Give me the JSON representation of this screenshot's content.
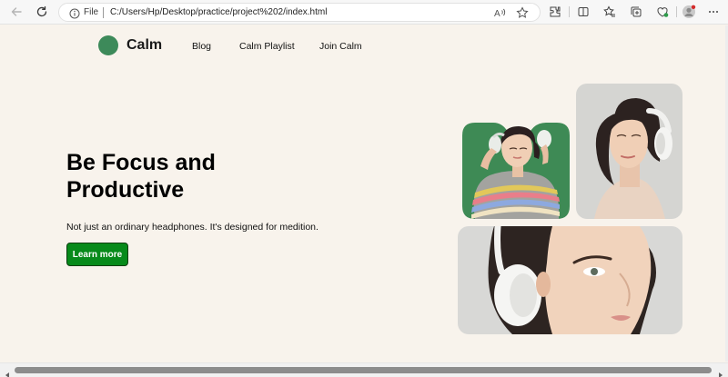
{
  "browser": {
    "url_scheme_label": "File",
    "url": "C:/Users/Hp/Desktop/practice/project%202/index.html",
    "icons": [
      "back-arrow-icon",
      "refresh-icon",
      "info-icon",
      "read-aloud-icon",
      "favorite-star-icon",
      "extensions-icon",
      "split-screen-icon",
      "favorites-icon",
      "collections-icon",
      "browser-essentials-icon",
      "profile-icon",
      "more-icon"
    ]
  },
  "site": {
    "logo_text": "Calm",
    "accent_color": "#3d8a5a",
    "nav": [
      {
        "label": "Blog"
      },
      {
        "label": "Calm Playlist"
      },
      {
        "label": "Join Calm"
      }
    ]
  },
  "hero": {
    "title": "Be Focus and Productive",
    "subtitle": "Not just an ordinary headphones. It's designed for medition.",
    "cta_label": "Learn more",
    "cta_color": "#078a1a"
  }
}
